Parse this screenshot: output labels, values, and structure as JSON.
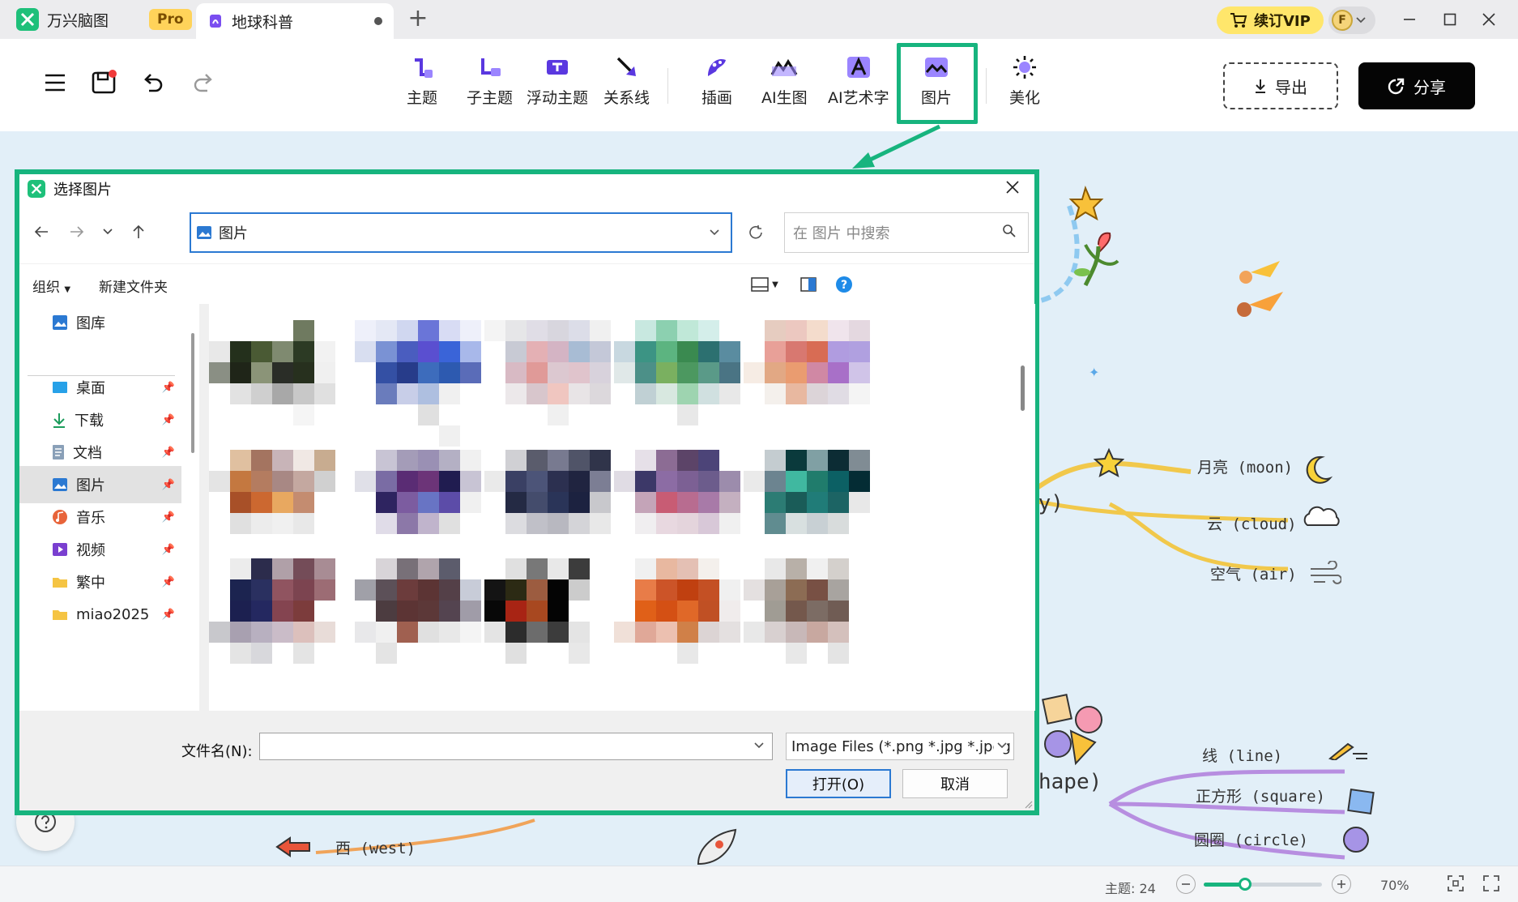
{
  "app": {
    "name": "万兴脑图",
    "pro_badge": "Pro",
    "document_tab": "地球科普",
    "vip_label": "续订VIP",
    "avatar_letter": "F",
    "colors": {
      "accent": "#17b47e",
      "vip": "#ffe66b",
      "share": "#050505",
      "link": "#2b79d2"
    }
  },
  "toolbar": {
    "tools": [
      {
        "label": "主题",
        "icon": "topic-icon"
      },
      {
        "label": "子主题",
        "icon": "subtopic-icon"
      },
      {
        "label": "浮动主题",
        "icon": "floating-topic-icon"
      },
      {
        "label": "关系线",
        "icon": "relation-line-icon"
      },
      {
        "label": "插画",
        "icon": "illustration-icon"
      },
      {
        "label": "AI生图",
        "icon": "ai-image-icon"
      },
      {
        "label": "AI艺术字",
        "icon": "ai-art-text-icon"
      },
      {
        "label": "图片",
        "icon": "image-icon"
      },
      {
        "label": "美化",
        "icon": "beautify-icon"
      }
    ],
    "export_label": "导出",
    "share_label": "分享"
  },
  "mindmap": {
    "branches": [
      {
        "label": "月亮 (moon)"
      },
      {
        "label": "云 (cloud)"
      },
      {
        "label": "空气 (air)"
      },
      {
        "label": "线 (line)"
      },
      {
        "label": "正方形 (square)"
      },
      {
        "label": "圆圈 (circle)"
      },
      {
        "label": "西 (west)"
      }
    ],
    "partial_ky": "ky)",
    "partial_shape": "hape)"
  },
  "status": {
    "topic_count": "主题: 24",
    "zoom": "70%",
    "zoom_level": 0.35
  },
  "dialog": {
    "title": "选择图片",
    "address": "图片",
    "search_placeholder": "在 图片 中搜索",
    "organize": "组织",
    "new_folder": "新建文件夹",
    "nav_items": [
      {
        "label": "图库",
        "icon": "gallery-icon"
      },
      {
        "label": "桌面",
        "icon": "desktop-icon"
      },
      {
        "label": "下载",
        "icon": "download-icon"
      },
      {
        "label": "文档",
        "icon": "documents-icon"
      },
      {
        "label": "图片",
        "icon": "pictures-icon"
      },
      {
        "label": "音乐",
        "icon": "music-icon"
      },
      {
        "label": "视频",
        "icon": "video-icon"
      },
      {
        "label": "繁中",
        "icon": "folder-icon"
      },
      {
        "label": "miao2025",
        "icon": "folder-icon"
      }
    ],
    "filename_label": "文件名(N):",
    "filename_value": "",
    "file_type": "Image Files (*.png *.jpg *.jpeg",
    "open_label": "打开(O)",
    "cancel_label": "取消"
  }
}
